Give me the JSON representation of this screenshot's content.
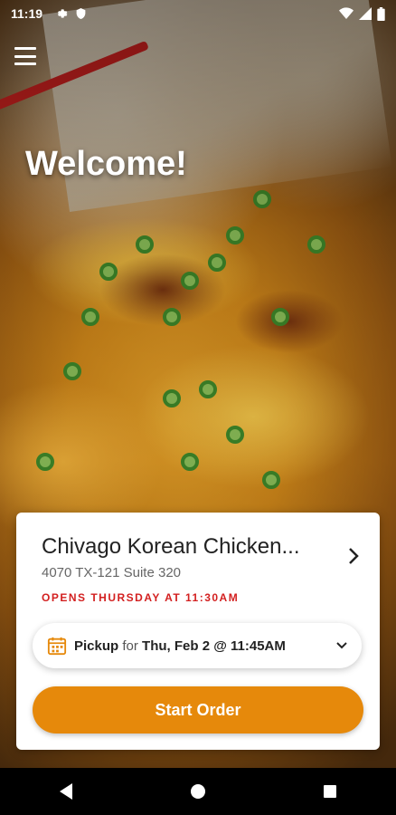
{
  "status_bar": {
    "time": "11:19",
    "icons_left": [
      "settings-icon",
      "shield-icon"
    ],
    "icons_right": [
      "wifi-icon",
      "signal-icon",
      "battery-icon"
    ]
  },
  "welcome": {
    "title": "Welcome!"
  },
  "store": {
    "name": "Chivago Korean Chicken...",
    "address": "4070 TX-121 Suite 320",
    "hours_status": "OPENS THURSDAY AT 11:30AM"
  },
  "pickup": {
    "mode": "Pickup",
    "connector": "for",
    "datetime": "Thu, Feb 2 @ 11:45AM"
  },
  "actions": {
    "start_order_label": "Start Order"
  },
  "colors": {
    "accent": "#e6890b",
    "hours_red": "#d32020",
    "calendar_orange": "#e6890b"
  }
}
